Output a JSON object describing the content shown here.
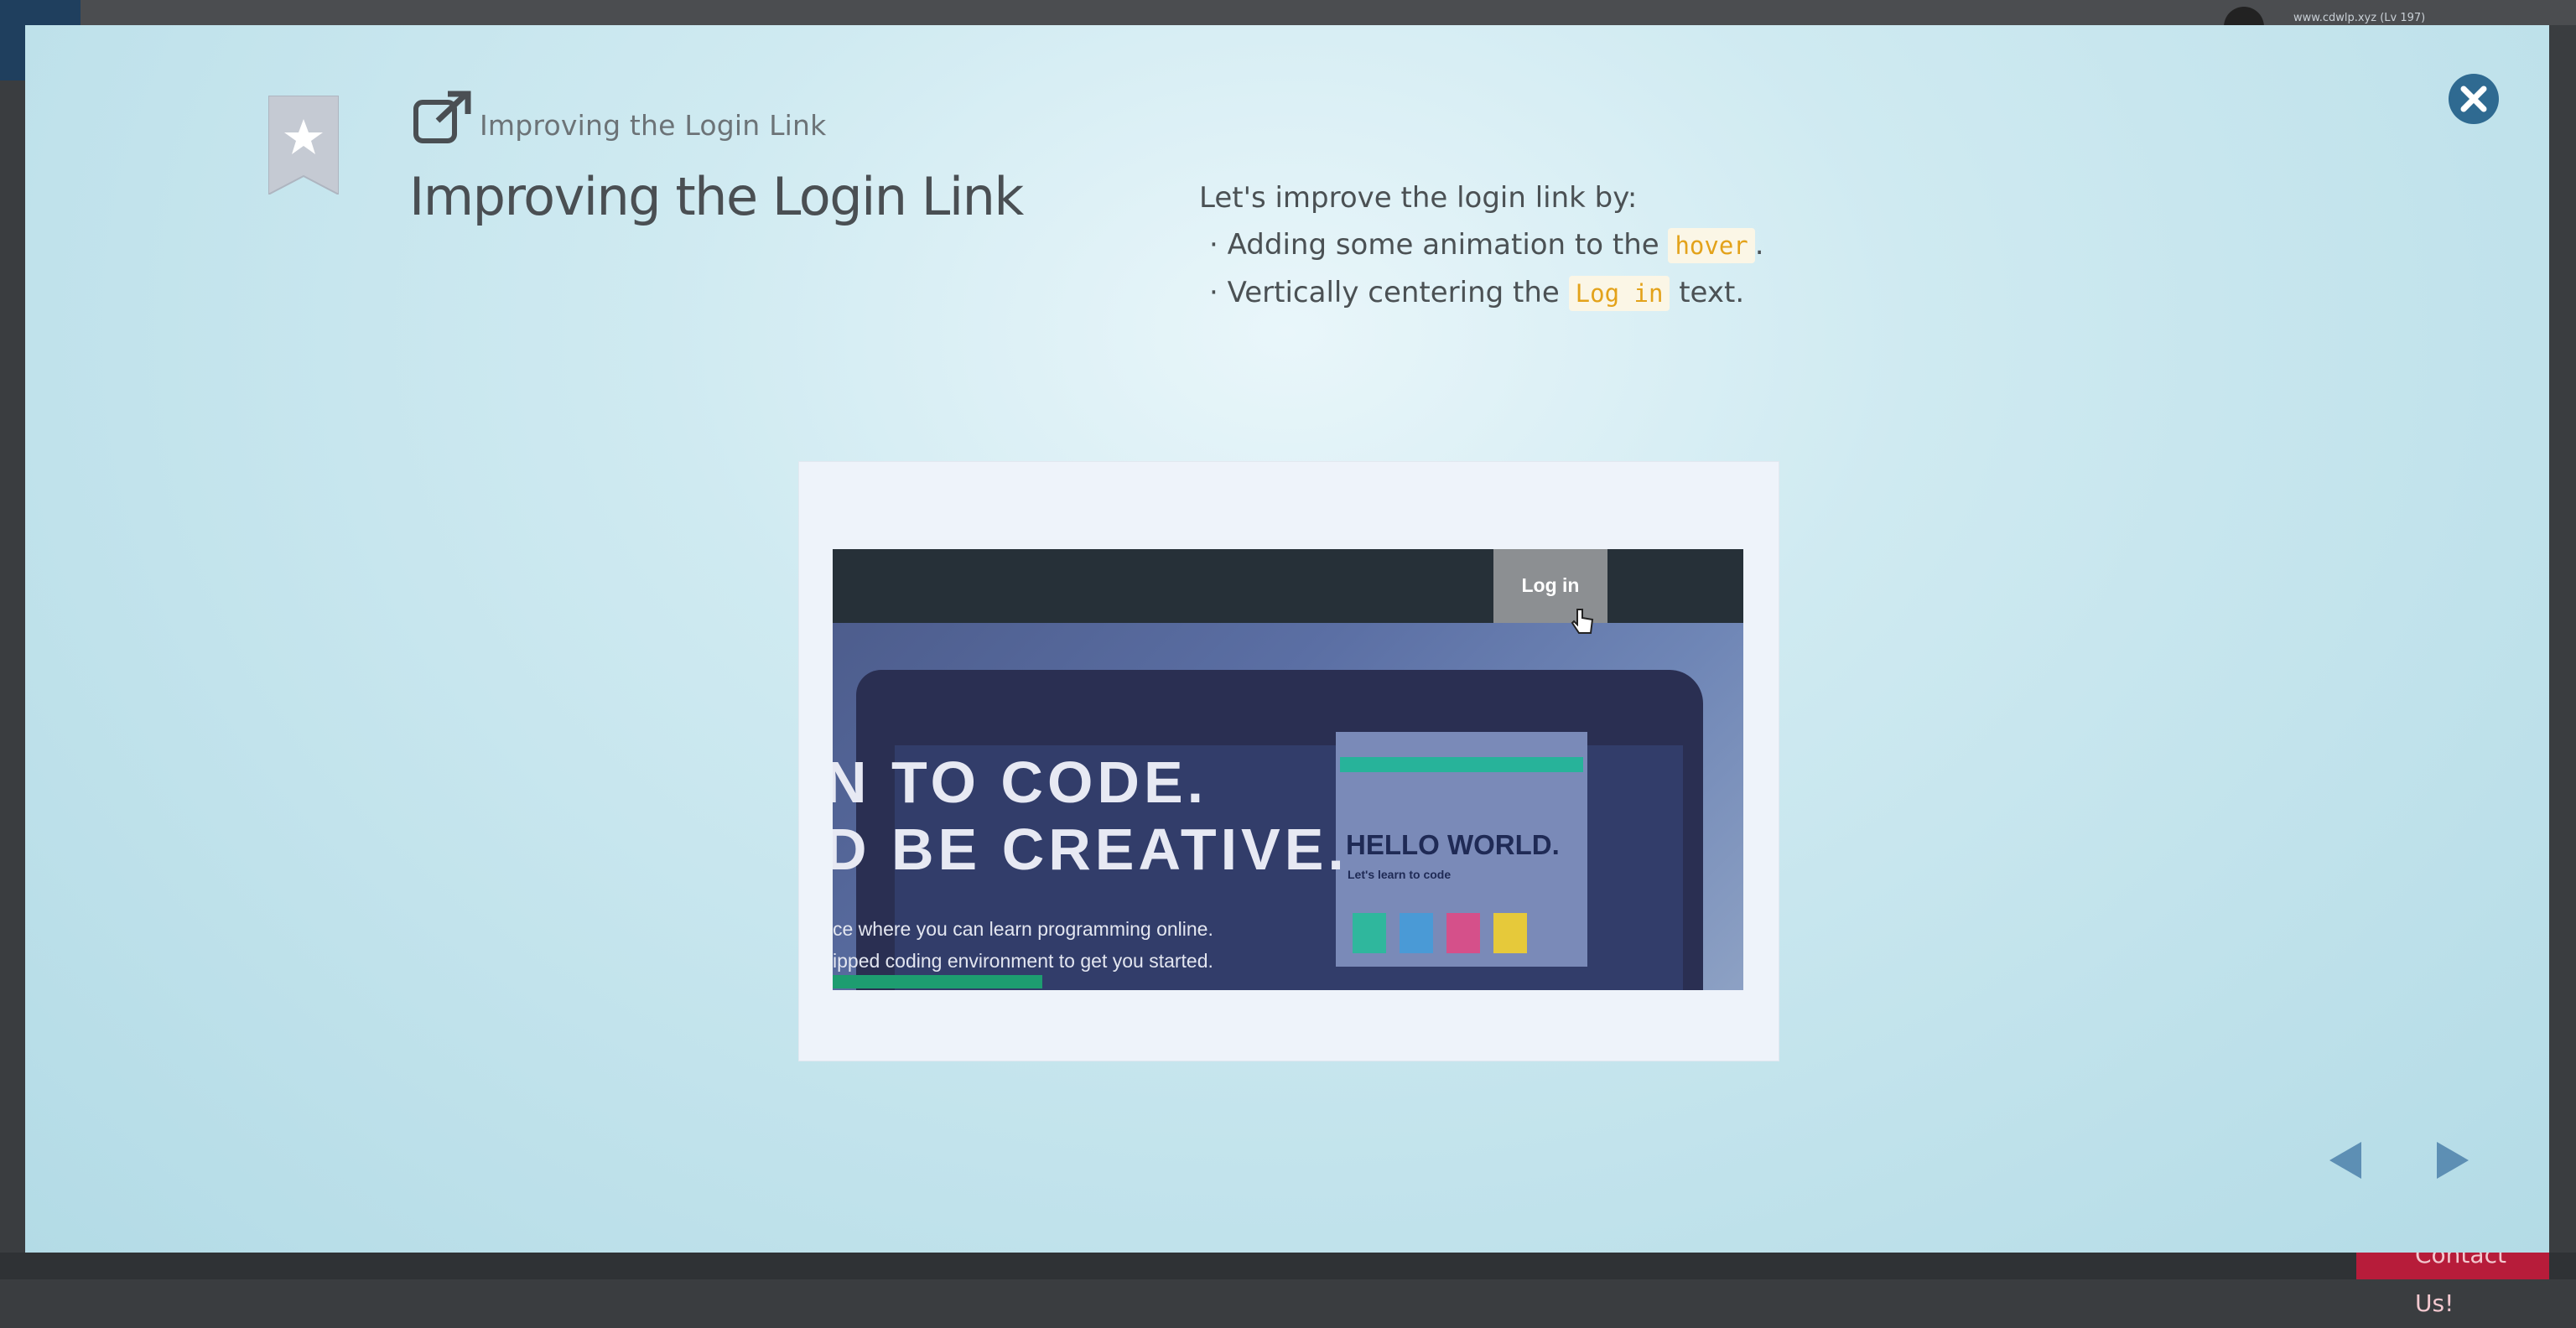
{
  "background": {
    "url_text": "www.cdwlp.xyz (Lv 197)",
    "contact_label": "Contact Us!"
  },
  "modal": {
    "breadcrumb": "Improving the Login Link",
    "title": "Improving the Login Link",
    "description": {
      "intro": "Let's improve the login link by:",
      "bullets": [
        {
          "before": "Adding some animation to the ",
          "code": "hover",
          "after": "."
        },
        {
          "before": "Vertically centering the ",
          "code": "Log in",
          "after": " text."
        }
      ]
    },
    "screenshot": {
      "login_label": "Log in",
      "hero_line1": "N TO CODE.",
      "hero_line2": "D BE CREATIVE.",
      "hero_sub1": "ce where you can learn programming online.",
      "hero_sub2": "ipped coding environment to get you started.",
      "preview_title": "HELLO WORLD.",
      "preview_subtitle": "Let's learn to code"
    },
    "icons": {
      "bookmark": "bookmark-star-icon",
      "external": "external-link-icon",
      "close": "close-icon",
      "prev": "arrow-left-icon",
      "next": "arrow-right-icon"
    },
    "colors": {
      "accent": "#2f6a91",
      "code_text": "#e3a21a",
      "nav_arrow": "#5d8fb4"
    }
  }
}
